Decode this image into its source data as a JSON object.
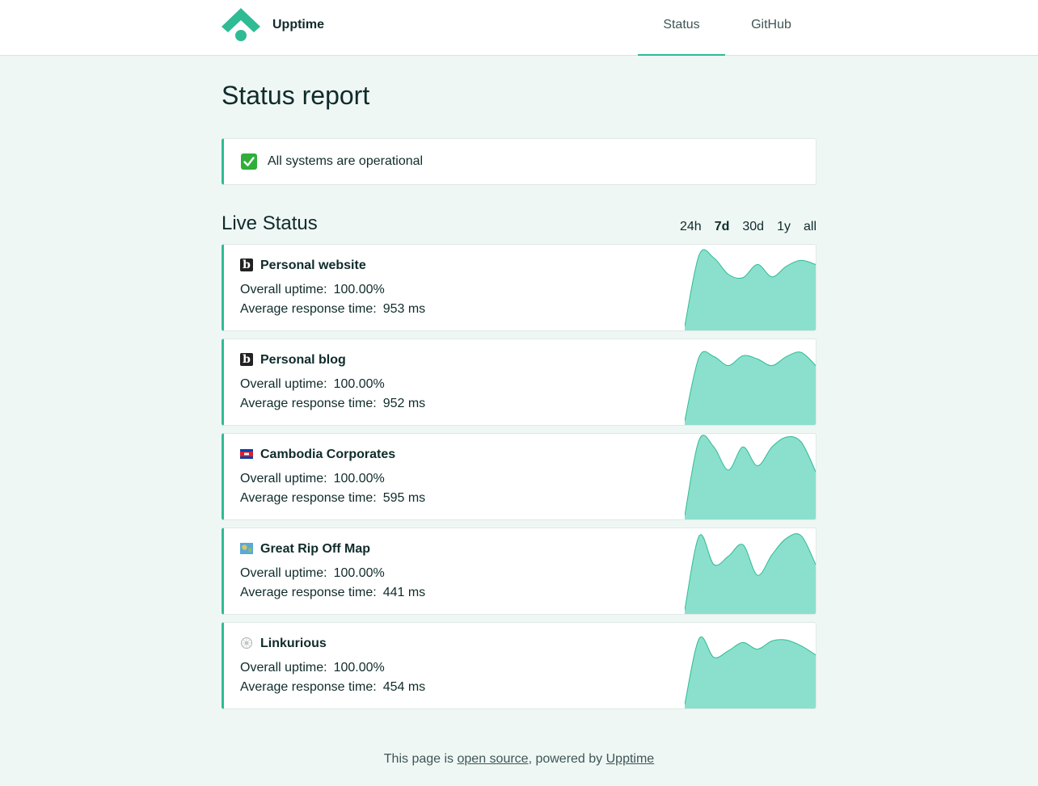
{
  "header": {
    "brand": "Upptime",
    "nav": [
      {
        "label": "Status",
        "active": true
      },
      {
        "label": "GitHub",
        "active": false
      }
    ],
    "accent_color": "#2fbb94"
  },
  "page_title": "Status report",
  "summary": {
    "icon": "check-mark-icon",
    "text": "All systems are operational"
  },
  "live": {
    "title": "Live Status",
    "ranges": [
      {
        "label": "24h",
        "active": false
      },
      {
        "label": "7d",
        "active": true
      },
      {
        "label": "30d",
        "active": false
      },
      {
        "label": "1y",
        "active": false
      },
      {
        "label": "all",
        "active": false
      }
    ],
    "uptime_label": "Overall uptime:",
    "response_label": "Average response time:",
    "sites": [
      {
        "name": "Personal website",
        "icon": "b-letter-icon",
        "uptime": "100.00%",
        "response": "953 ms",
        "trend": [
          0.05,
          0.92,
          0.88,
          0.68,
          0.64,
          0.8,
          0.65,
          0.78,
          0.85,
          0.8
        ]
      },
      {
        "name": "Personal blog",
        "icon": "b-letter-icon",
        "uptime": "100.00%",
        "response": "952 ms",
        "trend": [
          0.05,
          0.83,
          0.83,
          0.72,
          0.84,
          0.8,
          0.72,
          0.83,
          0.88,
          0.72
        ]
      },
      {
        "name": "Cambodia Corporates",
        "icon": "cambodia-flag-icon",
        "uptime": "100.00%",
        "response": "595 ms",
        "trend": [
          0.05,
          0.97,
          0.88,
          0.6,
          0.88,
          0.65,
          0.88,
          1.0,
          0.94,
          0.58
        ]
      },
      {
        "name": "Great Rip Off Map",
        "icon": "map-icon",
        "uptime": "100.00%",
        "response": "441 ms",
        "trend": [
          0.05,
          0.95,
          0.6,
          0.7,
          0.84,
          0.47,
          0.72,
          0.92,
          0.95,
          0.6
        ]
      },
      {
        "name": "Linkurious",
        "icon": "graph-network-icon",
        "uptime": "100.00%",
        "response": "454 ms",
        "trend": [
          0.05,
          0.85,
          0.62,
          0.7,
          0.8,
          0.72,
          0.82,
          0.83,
          0.76,
          0.65
        ]
      }
    ]
  },
  "footer": {
    "prefix": "This page is",
    "link1": "open source",
    "middle": ", powered by",
    "link2": "Upptime"
  }
}
